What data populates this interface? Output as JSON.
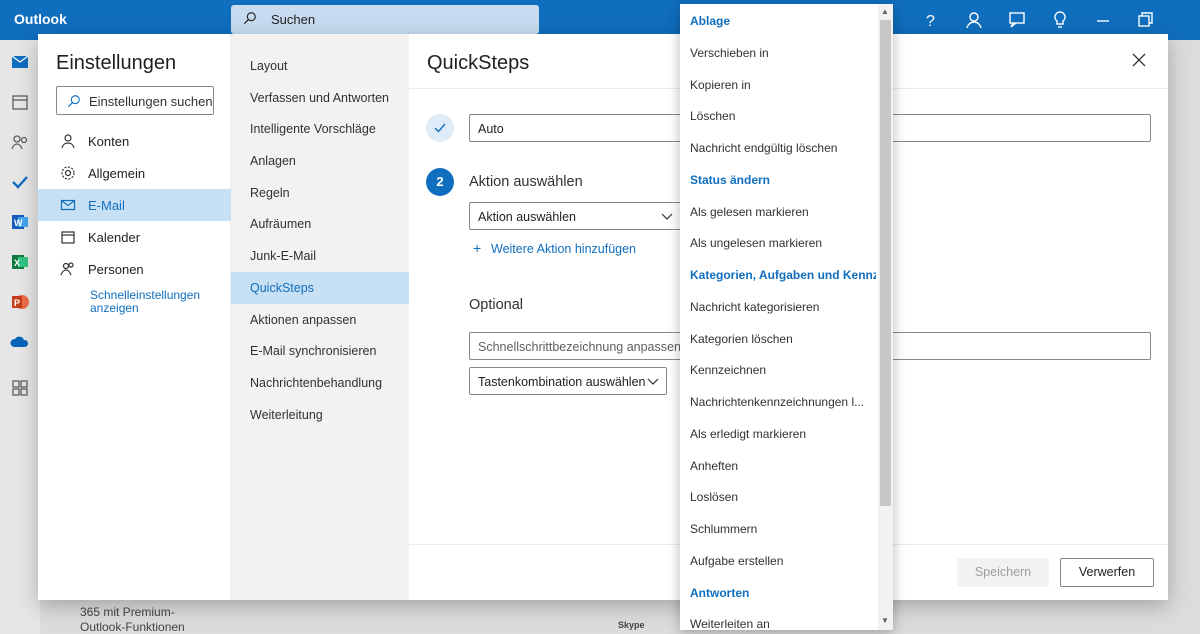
{
  "app": {
    "name": "Outlook"
  },
  "search": {
    "placeholder": "Suchen"
  },
  "background": {
    "footer_line1": "365 mit Premium-",
    "footer_line2": "Outlook-Funktionen",
    "skype": "Skype"
  },
  "settings": {
    "title": "Einstellungen",
    "search_placeholder": "Einstellungen suchen",
    "categories": [
      {
        "label": "Konten",
        "icon": "person-icon"
      },
      {
        "label": "Allgemein",
        "icon": "gear-icon"
      },
      {
        "label": "E-Mail",
        "icon": "mail-icon",
        "active": true
      },
      {
        "label": "Kalender",
        "icon": "calendar-icon"
      },
      {
        "label": "Personen",
        "icon": "people-icon"
      }
    ],
    "quick_settings_link": "Schnelleinstellungen anzeigen",
    "mail_sections": [
      "Layout",
      "Verfassen und Antworten",
      "Intelligente Vorschläge",
      "Anlagen",
      "Regeln",
      "Aufräumen",
      "Junk-E-Mail",
      "QuickSteps",
      "Aktionen anpassen",
      "E-Mail synchronisieren",
      "Nachrichtenbehandlung",
      "Weiterleitung"
    ],
    "active_section": "QuickSteps"
  },
  "quicksteps": {
    "title": "QuickSteps",
    "step1_value": "Auto",
    "step2_number": "2",
    "step2_label": "Aktion auswählen",
    "action_select_value": "Aktion auswählen",
    "add_action_label": "Weitere Aktion hinzufügen",
    "optional_label": "Optional",
    "name_placeholder": "Schnellschrittbezeichnung anpassen",
    "shortcut_value": "Tastenkombination auswählen",
    "save_label": "Speichern",
    "discard_label": "Verwerfen"
  },
  "dropdown": {
    "items": [
      {
        "type": "header",
        "label": "Ablage"
      },
      {
        "type": "option",
        "label": "Verschieben in"
      },
      {
        "type": "option",
        "label": "Kopieren in"
      },
      {
        "type": "option",
        "label": "Löschen"
      },
      {
        "type": "option",
        "label": "Nachricht endgültig löschen"
      },
      {
        "type": "header",
        "label": "Status ändern"
      },
      {
        "type": "option",
        "label": "Als gelesen markieren"
      },
      {
        "type": "option",
        "label": "Als ungelesen markieren"
      },
      {
        "type": "header",
        "label": "Kategorien, Aufgaben und Kennze"
      },
      {
        "type": "option",
        "label": "Nachricht kategorisieren"
      },
      {
        "type": "option",
        "label": "Kategorien löschen"
      },
      {
        "type": "option",
        "label": "Kennzeichnen"
      },
      {
        "type": "option",
        "label": "Nachrichtenkennzeichnungen l..."
      },
      {
        "type": "option",
        "label": "Als erledigt markieren"
      },
      {
        "type": "option",
        "label": "Anheften"
      },
      {
        "type": "option",
        "label": "Loslösen"
      },
      {
        "type": "option",
        "label": "Schlummern"
      },
      {
        "type": "option",
        "label": "Aufgabe erstellen"
      },
      {
        "type": "header",
        "label": "Antworten"
      },
      {
        "type": "option",
        "label": "Weiterleiten an"
      }
    ]
  }
}
